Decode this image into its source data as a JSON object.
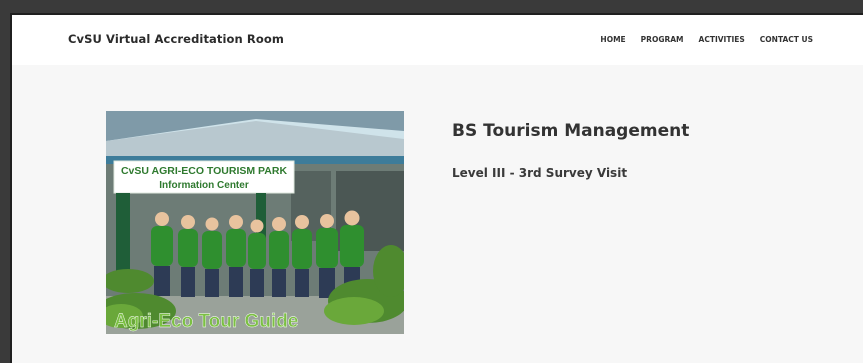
{
  "header": {
    "site_title": "CvSU Virtual Accreditation Room",
    "nav": [
      "HOME",
      "PROGRAM",
      "ACTIVITIES",
      "CONTACT US"
    ]
  },
  "main": {
    "program_title": "BS Tourism Management",
    "program_subtitle": "Level III - 3rd Survey Visit",
    "photo": {
      "sign_line1": "CvSU AGRI-ECO TOURISM PARK",
      "sign_line2": "Information Center",
      "caption": "Agri-Eco Tour Guide"
    }
  },
  "colors": {
    "navbar_bg": "#ffffff",
    "page_bg": "#f7f7f7",
    "text_dark": "#333333",
    "shirt_green": "#2f8f2f",
    "caption_green": "#7bc043"
  }
}
